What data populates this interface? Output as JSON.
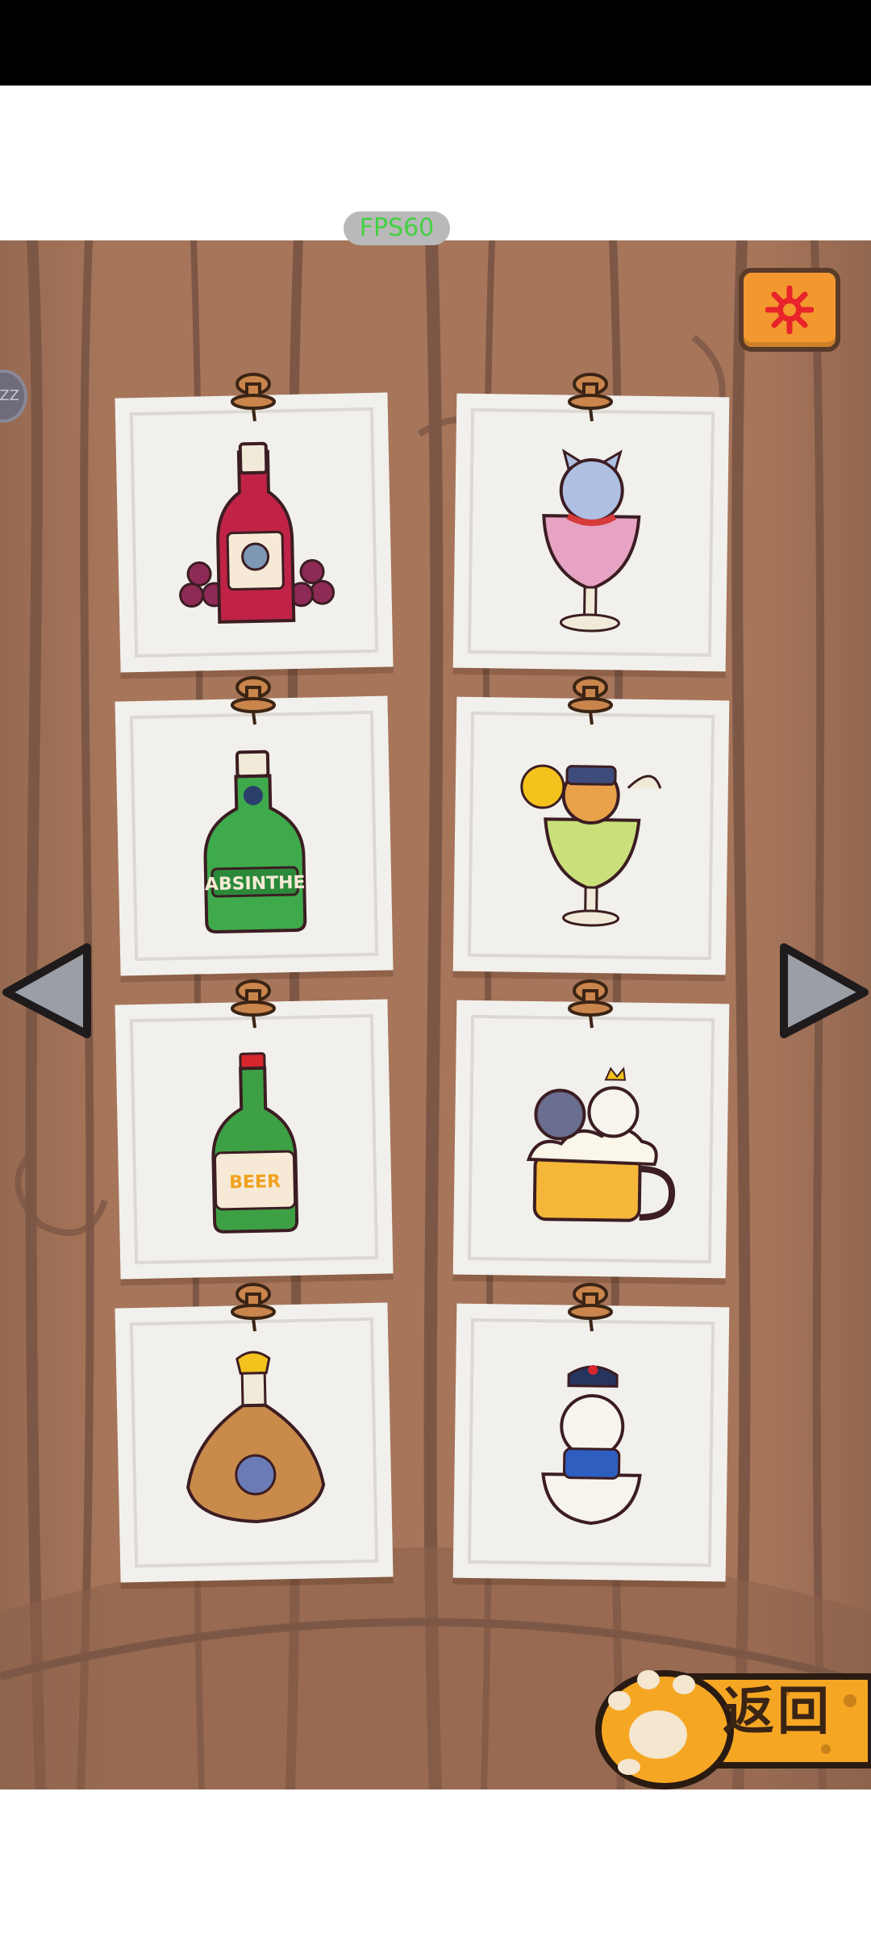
{
  "fps_badge": "FPS60",
  "side_handle_text": "ZZ",
  "back_button": {
    "label": "返回"
  },
  "colors": {
    "wood": "#a6755a",
    "wood_dark": "#7d5746",
    "card": "#f2f0ec",
    "settings_orange": "#f2982f",
    "paw_orange": "#f5a623"
  },
  "icons": {
    "settings": "gear-icon",
    "prev": "triangle-left-icon",
    "next": "triangle-right-icon",
    "pin": "push-pin-icon"
  },
  "cards": [
    {
      "name": "red-wine-bottle",
      "kind": "bottle"
    },
    {
      "name": "cat-in-wine-glass",
      "kind": "cat-glass"
    },
    {
      "name": "absinthe-bottle",
      "kind": "bottle",
      "text": "ABSINTHE"
    },
    {
      "name": "cat-in-absinthe-glass",
      "kind": "cat-glass"
    },
    {
      "name": "beer-bottle",
      "kind": "bottle",
      "text": "BEER"
    },
    {
      "name": "cats-in-beer-mug",
      "kind": "cat-glass"
    },
    {
      "name": "baijiu-bottle",
      "kind": "bottle"
    },
    {
      "name": "cat-in-baijiu-bowl",
      "kind": "cat-glass"
    }
  ]
}
